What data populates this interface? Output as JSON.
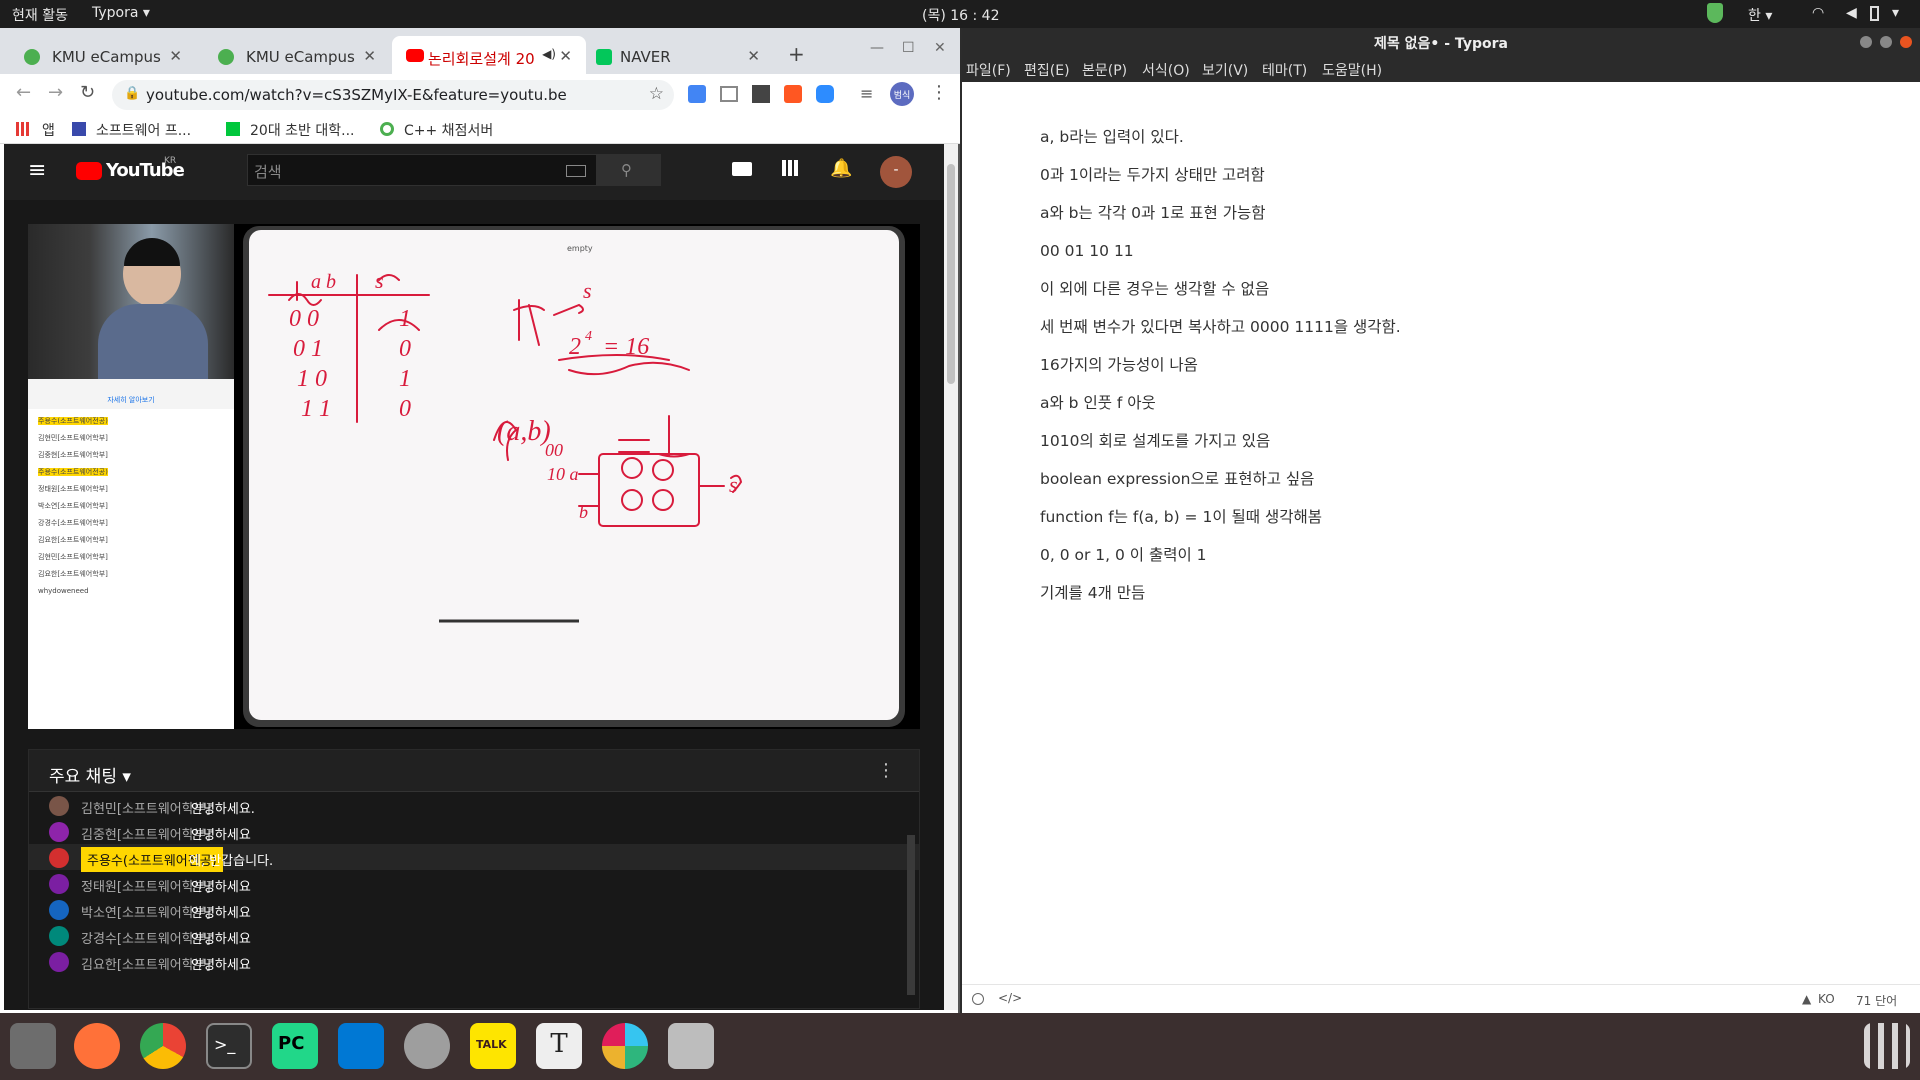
{
  "topbar": {
    "activities": "현재 활동",
    "app": "Typora ▾",
    "clock": "(목) 16 : 42",
    "lang": "한 ▾"
  },
  "chrome": {
    "tabs": [
      {
        "label": "KMU eCampus"
      },
      {
        "label": "KMU eCampus"
      },
      {
        "label": "논리회로설계 20"
      },
      {
        "label": "NAVER"
      }
    ],
    "url": "youtube.com/watch?v=cS3SZMyIX-E&feature=youtu.be",
    "bookmarks": [
      "앱",
      "소프트웨어 프...",
      "20대 초반 대학...",
      "C++ 채점서버"
    ],
    "profile": "범식"
  },
  "youtube": {
    "logo": "YouTube",
    "region": "KR",
    "search_placeholder": "검색",
    "avatar": "-",
    "chat_title": "주요 채팅 ▾",
    "messages": [
      {
        "name": "김현민[소프트웨어학부]",
        "text": "안녕하세요.",
        "color": "#795548"
      },
      {
        "name": "김중현[소프트웨어학부]",
        "text": "안녕하세요",
        "color": "#8e24aa"
      },
      {
        "name": "주용수(소프트웨어전공)",
        "text": "예, 반갑습니다.",
        "color": "#d32f2f",
        "owner": true
      },
      {
        "name": "정태원[소프트웨어학부]",
        "text": "안녕하세요",
        "color": "#7b1fa2"
      },
      {
        "name": "박소연[소프트웨어학부]",
        "text": "안녕하세요",
        "color": "#1565c0"
      },
      {
        "name": "강경수[소프트웨어학부]",
        "text": "안녕하세요",
        "color": "#00897b"
      },
      {
        "name": "김요한[소프트웨어학부]",
        "text": "안녕하세요",
        "color": "#7b1fa2"
      }
    ],
    "inner_chat": {
      "notice": "자세히 알아보기",
      "rows": [
        "주용수(소프트웨어전공)",
        "김현민[소프트웨어학부]",
        "김중현[소프트웨어학부]",
        "주용수(소프트웨어전공)",
        "정태원[소프트웨어학부]",
        "박소연[소프트웨어학부]",
        "강경수[소프트웨어학부]",
        "김요한[소프트웨어학부]",
        "김현민[소프트웨어학부]",
        "김요한[소프트웨어학부]",
        "whydoweneed"
      ]
    },
    "tablet_title": "empty"
  },
  "typora": {
    "title": "제목 없음• - Typora",
    "menu": [
      "파일(F)",
      "편집(E)",
      "본문(P)",
      "서식(O)",
      "보기(V)",
      "테마(T)",
      "도움말(H)"
    ],
    "lines": [
      "a, b라는 입력이 있다.",
      "0과 1이라는 두가지 상태만 고려함",
      "a와 b는 각각 0과 1로 표현 가능함",
      "00 01 10 11",
      "이 외에 다른 경우는 생각할 수 없음",
      "세 번째 변수가 있다면 복사하고 0000 1111을 생각함.",
      "16가지의 가능성이 나옴",
      "a와 b 인풋 f 아웃",
      "1010의 회로 설계도를 가지고 있음",
      "boolean expression으로 표현하고 싶음",
      "function f는 f(a, b) = 1이 될때 생각해봄",
      "0, 0 or 1, 0 이 출력이 1",
      "기계를 4개 만듬"
    ],
    "status_lang": "KO",
    "word_count": "71 단어"
  },
  "dock": [
    "files",
    "firefox",
    "chrome",
    "terminal",
    "pycharm",
    "vscode",
    "settings",
    "kakaotalk",
    "typora",
    "slack",
    "screenshot",
    "app-grid"
  ]
}
